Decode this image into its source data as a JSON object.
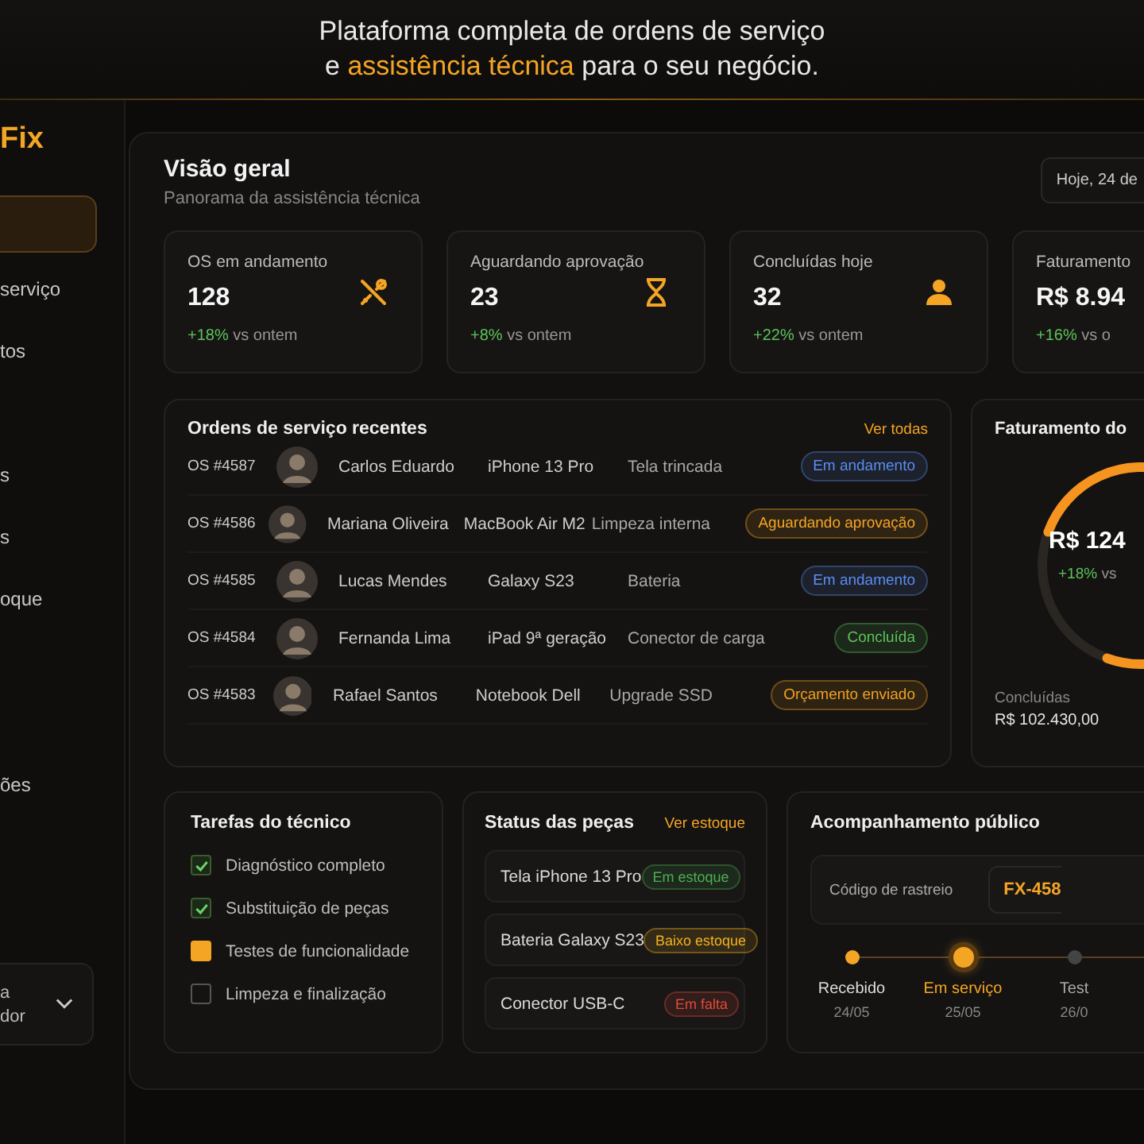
{
  "header": {
    "line1": "Plataforma completa de ordens de serviço",
    "line2": [
      {
        "text": "e ",
        "highlight": false
      },
      {
        "text": "assistência técnica",
        "highlight": true
      },
      {
        "text": " para o seu negócio.",
        "highlight": false
      }
    ]
  },
  "sidebar": {
    "logo": "Fix",
    "sections": [
      {
        "items": [
          {
            "selected": true
          },
          {
            "label": "serviço",
            "selected": false
          },
          {
            "label": "tos",
            "selected": false
          }
        ]
      },
      {
        "items": [
          {
            "label": "s",
            "selected": false
          },
          {
            "label": "s",
            "selected": false
          },
          {
            "label": "oque",
            "selected": false
          }
        ]
      },
      {
        "items": [
          {
            "label": "ões",
            "selected": false
          }
        ]
      }
    ],
    "user": {
      "line1": "a",
      "line2": "dor"
    }
  },
  "overview": {
    "title": "Visão geral",
    "subtitle": "Panorama da assistência técnica",
    "date": "Hoje, 24 de"
  },
  "stats": [
    {
      "label": "OS em andamento",
      "value": "128",
      "change": "+18%",
      "note": "vs ontem",
      "kind": "tools"
    },
    {
      "label": "Aguardando aprovação",
      "value": "23",
      "change": "+8%",
      "note": "vs ontem",
      "kind": "hourglass"
    },
    {
      "label": "Concluídas hoje",
      "value": "32",
      "change": "+22%",
      "note": "vs ontem",
      "kind": "person"
    },
    {
      "label": "Faturamento",
      "value": "R$ 8.94",
      "change": "+16%",
      "note": "vs o",
      "kind": "plain"
    }
  ],
  "orders": {
    "title": "Ordens de serviço recentes",
    "link": "Ver todas",
    "rows": [
      {
        "id": "OS #4587",
        "client": "Carlos Eduardo",
        "device": "iPhone 13 Pro",
        "issue": "Tela trincada",
        "status": "Em andamento",
        "color": "#5b8def"
      },
      {
        "id": "OS #4586",
        "client": "Mariana Oliveira",
        "device": "MacBook Air M2",
        "issue": "Limpeza interna",
        "status": "Aguardando aprovação",
        "color": "#f5a524"
      },
      {
        "id": "OS #4585",
        "client": "Lucas Mendes",
        "device": "Galaxy S23",
        "issue": "Bateria",
        "status": "Em andamento",
        "color": "#5b8def"
      },
      {
        "id": "OS #4584",
        "client": "Fernanda Lima",
        "device": "iPad 9ª geração",
        "issue": "Conector de carga",
        "status": "Concluída",
        "color": "#5cc25a"
      },
      {
        "id": "OS #4583",
        "client": "Rafael Santos",
        "device": "Notebook Dell",
        "issue": "Upgrade SSD",
        "status": "Orçamento enviado",
        "color": "#f0a020"
      }
    ]
  },
  "revenue": {
    "title": "Faturamento do",
    "value": "R$ 124",
    "change": "+18%",
    "note": "vs",
    "label": "Concluídas",
    "amount": "R$ 102.430,00"
  },
  "tasks": {
    "title": "Tarefas do técnico",
    "items": [
      {
        "label": "Diagnóstico completo",
        "kind": "done"
      },
      {
        "label": "Substituição de peças",
        "kind": "done"
      },
      {
        "label": "Testes de funcionalidade",
        "kind": "active"
      },
      {
        "label": "Limpeza e finalização",
        "kind": "open"
      }
    ]
  },
  "parts": {
    "title": "Status das peças",
    "link": "Ver estoque",
    "items": [
      {
        "name": "Tela iPhone 13 Pro",
        "status": "Em estoque",
        "color": "#4caf50"
      },
      {
        "name": "Bateria Galaxy S23",
        "status": "Baixo estoque",
        "color": "#f5b11f"
      },
      {
        "name": "Conector USB-C",
        "status": "Em falta",
        "color": "#e5483d"
      }
    ]
  },
  "tracking": {
    "title": "Acompanhamento público",
    "code_label": "Código de rastreio",
    "code": "FX-458",
    "steps": [
      {
        "label": "Recebido",
        "date": "24/05",
        "kind": "done"
      },
      {
        "label": "Em serviço",
        "date": "25/05",
        "kind": "current"
      },
      {
        "label": "Test",
        "date": "26/0",
        "kind": "pending"
      }
    ]
  }
}
